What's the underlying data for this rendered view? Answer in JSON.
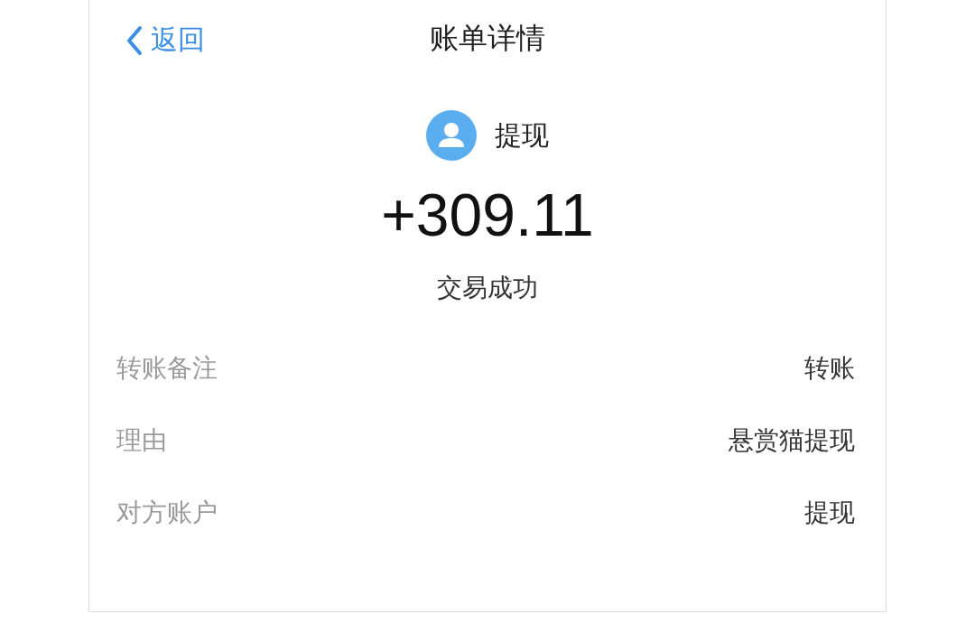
{
  "nav": {
    "back": "返回",
    "title": "账单详情"
  },
  "summary": {
    "name": "提现",
    "amount": "+309.11",
    "status": "交易成功"
  },
  "details": [
    {
      "label": "转账备注",
      "value": "转账"
    },
    {
      "label": "理由",
      "value": "悬赏猫提现"
    },
    {
      "label": "对方账户",
      "value": "提现"
    }
  ]
}
